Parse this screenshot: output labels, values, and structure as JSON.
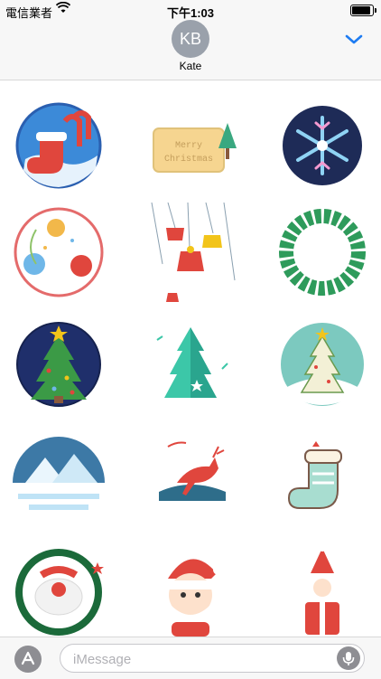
{
  "status_bar": {
    "carrier": "電信業者",
    "time": "下午1:03"
  },
  "contact": {
    "initials": "KB",
    "name": "Kate"
  },
  "stickers": [
    {
      "name": "stocking-candy-cane"
    },
    {
      "name": "merry-christmas-card",
      "text": "Merry Christmas"
    },
    {
      "name": "snowflake-dark"
    },
    {
      "name": "bells-ring"
    },
    {
      "name": "hanging-bells"
    },
    {
      "name": "wreath-snowflake"
    },
    {
      "name": "tree-night"
    },
    {
      "name": "tree-teal"
    },
    {
      "name": "tree-circle"
    },
    {
      "name": "snow-mountains"
    },
    {
      "name": "reindeer"
    },
    {
      "name": "stocking-mint"
    },
    {
      "name": "santa-wreath"
    },
    {
      "name": "santa-cute"
    },
    {
      "name": "santa-standing"
    }
  ],
  "compose": {
    "placeholder": "iMessage"
  },
  "colors": {
    "accent": "#1e7cf2",
    "red": "#e0463d",
    "green": "#2e9b5b",
    "navy": "#1e2b57"
  }
}
